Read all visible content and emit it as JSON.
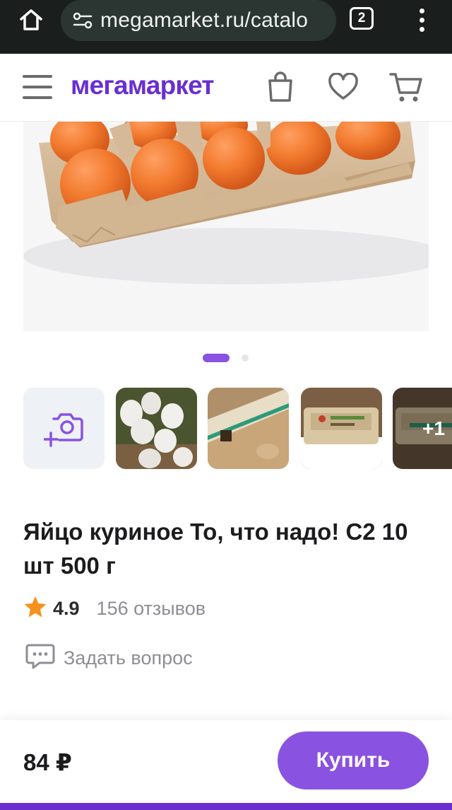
{
  "browser": {
    "url": "megamarket.ru/catalo",
    "tab_count": "2"
  },
  "header": {
    "logo": "мегамаркет",
    "icons": [
      "menu-icon",
      "bag-icon",
      "heart-icon",
      "cart-icon"
    ]
  },
  "gallery": {
    "active_index": 0,
    "total_slides": 2,
    "thumbnails_more": "+1"
  },
  "product": {
    "title": "Яйцо куриное То, что надо! С2 10 шт 500 г",
    "rating": "4.9",
    "reviews": "156 отзывов",
    "ask_question": "Задать вопрос"
  },
  "buy_bar": {
    "price": "84 ₽",
    "buy_label": "Купить"
  },
  "colors": {
    "brand": "#6a2fd1",
    "accent": "#8a52e0",
    "star": "#f6911e"
  }
}
